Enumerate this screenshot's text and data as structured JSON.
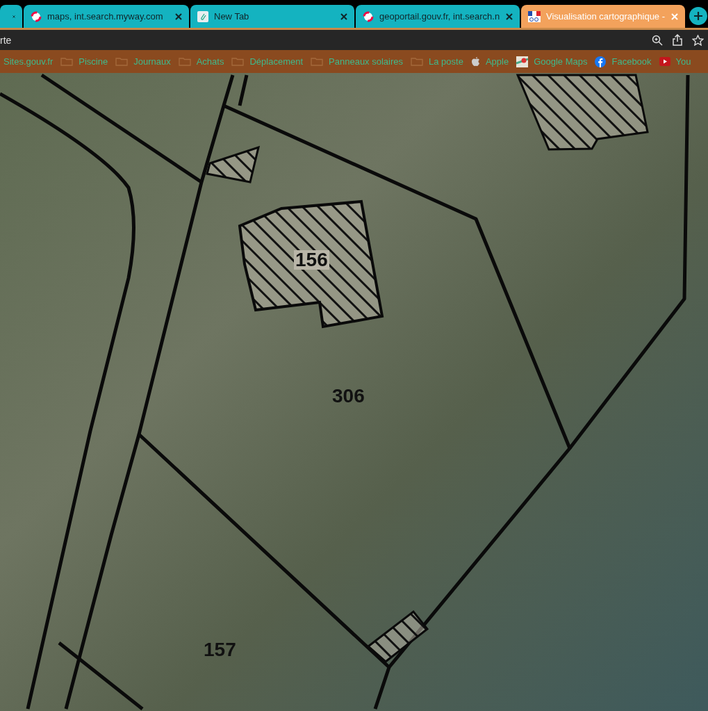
{
  "tabs": [
    {
      "selected": false
    },
    {
      "title": "maps, int.search.myway.com",
      "kind": "myway",
      "selected": false
    },
    {
      "title": "New Tab",
      "kind": "clip",
      "selected": false
    },
    {
      "title": "geoportail.gouv.fr, int.search.n",
      "kind": "myway",
      "selected": false
    },
    {
      "title": "Visualisation cartographique -",
      "kind": "geo",
      "selected": true
    }
  ],
  "address_bar": {
    "value": "rte"
  },
  "bookmarks": [
    {
      "label": "Sites.gouv.fr",
      "kind": "plain"
    },
    {
      "label": "Piscine",
      "kind": "folder"
    },
    {
      "label": "Journaux",
      "kind": "folder"
    },
    {
      "label": "Achats",
      "kind": "folder"
    },
    {
      "label": "Déplacement",
      "kind": "folder"
    },
    {
      "label": "Panneaux solaires",
      "kind": "folder"
    },
    {
      "label": "La poste",
      "kind": "folder"
    },
    {
      "label": "Apple",
      "kind": "apple"
    },
    {
      "label": "Google Maps",
      "kind": "maps"
    },
    {
      "label": "Facebook",
      "kind": "facebook"
    },
    {
      "label": "You",
      "kind": "youtube"
    }
  ],
  "map": {
    "parcel_labels": [
      "156",
      "306",
      "157"
    ]
  }
}
